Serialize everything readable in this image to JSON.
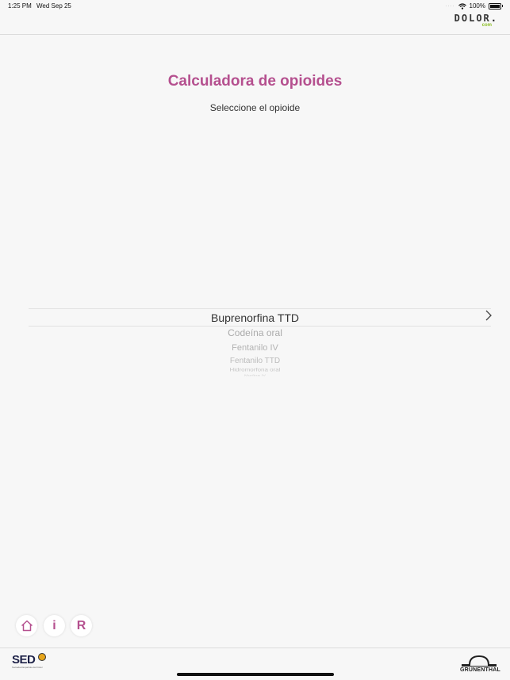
{
  "status_bar": {
    "time": "1:25 PM",
    "date": "Wed Sep 25",
    "signal": "····",
    "battery_text": "100%"
  },
  "header": {
    "logo_main": "DOLOR",
    "logo_dot": ".",
    "logo_sub": "com"
  },
  "main": {
    "title": "Calculadora de opioides",
    "subtitle": "Seleccione el opioide"
  },
  "picker": {
    "selected": "Buprenorfina TTD",
    "options": [
      "Codeína oral",
      "Fentanilo IV",
      "Fentanilo TTD",
      "Hidromorfona oral",
      "Morfina IV"
    ]
  },
  "bottom_buttons": {
    "home_icon": "home-icon",
    "info_label": "i",
    "reset_label": "R"
  },
  "footer": {
    "sed_label": "SED",
    "sed_sub": "Sociedad Española del Dolor",
    "grunenthal_label": "GRÜNENTHAL"
  },
  "colors": {
    "accent": "#b5508f",
    "logo_green": "#8cbf26",
    "background": "#f7f7f7"
  }
}
